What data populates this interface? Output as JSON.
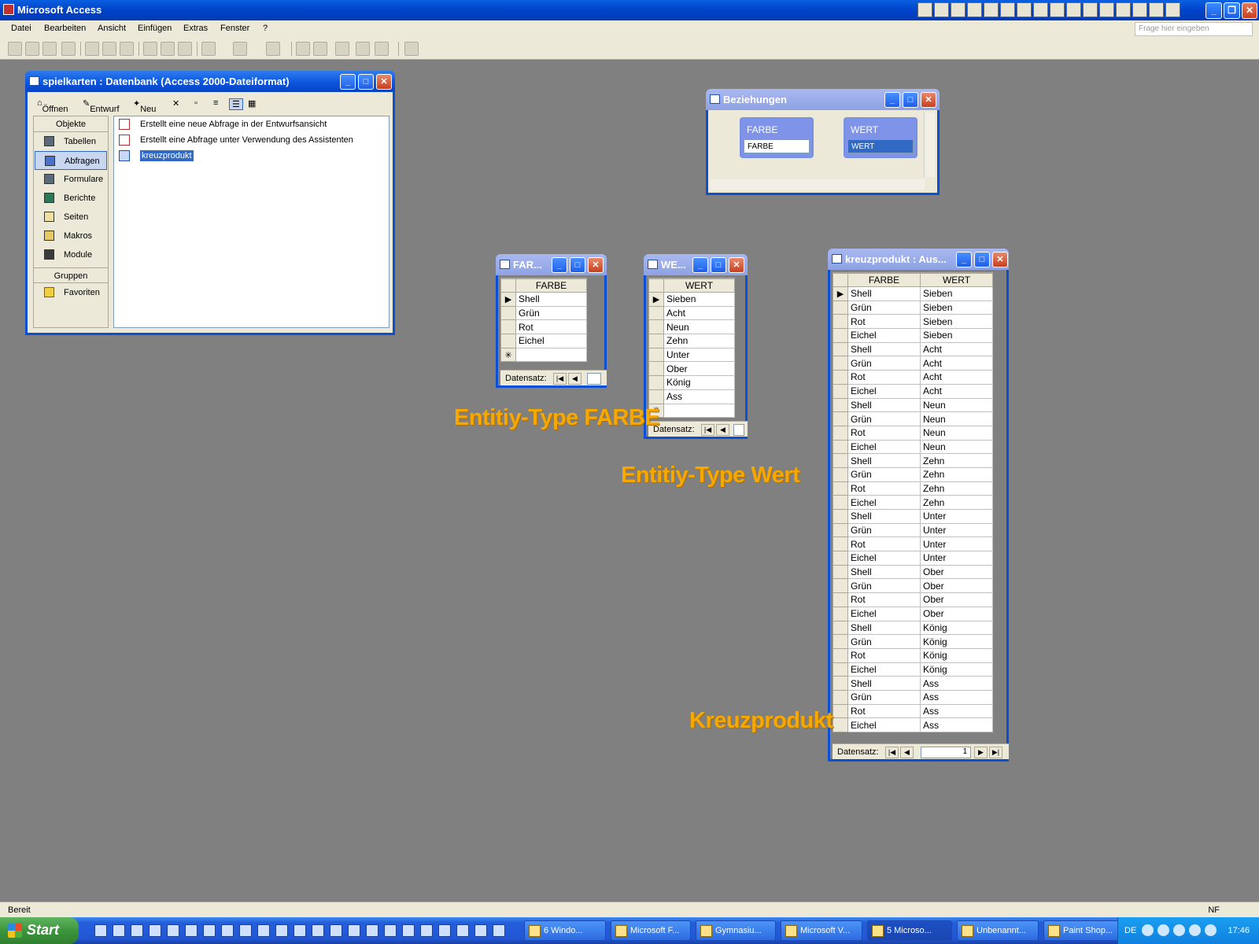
{
  "app": {
    "title": "Microsoft Access",
    "help_placeholder": "Frage hier eingeben",
    "status_left": "Bereit",
    "status_right": "NF"
  },
  "menu": [
    "Datei",
    "Bearbeiten",
    "Ansicht",
    "Einfügen",
    "Extras",
    "Fenster",
    "?"
  ],
  "db_window": {
    "title": "spielkarten : Datenbank (Access 2000-Dateiformat)",
    "toolbar": {
      "open": "Öffnen",
      "design": "Entwurf",
      "new": "Neu"
    },
    "objects_header": "Objekte",
    "objects": [
      "Tabellen",
      "Abfragen",
      "Formulare",
      "Berichte",
      "Seiten",
      "Makros",
      "Module"
    ],
    "selected_object": "Abfragen",
    "groups_header": "Gruppen",
    "groups": [
      "Favoriten"
    ],
    "list": [
      "Erstellt eine neue Abfrage in der Entwurfsansicht",
      "Erstellt eine Abfrage unter Verwendung des Assistenten",
      "kreuzprodukt"
    ]
  },
  "relationships": {
    "title": "Beziehungen",
    "tables": [
      {
        "name": "FARBE",
        "field": "FARBE"
      },
      {
        "name": "WERT",
        "field": "WERT"
      }
    ]
  },
  "farbe_table": {
    "title": "FAR...",
    "column": "FARBE",
    "rows": [
      "Shell",
      "Grün",
      "Rot",
      "Eichel"
    ],
    "nav_label": "Datensatz:"
  },
  "wert_table": {
    "title": "WE...",
    "column": "WERT",
    "rows": [
      "Sieben",
      "Acht",
      "Neun",
      "Zehn",
      "Unter",
      "Ober",
      "König",
      "Ass"
    ],
    "nav_label": "Datensatz:"
  },
  "kreuz_table": {
    "title": "kreuzprodukt : Aus...",
    "columns": [
      "FARBE",
      "WERT"
    ],
    "rows": [
      [
        "Shell",
        "Sieben"
      ],
      [
        "Grün",
        "Sieben"
      ],
      [
        "Rot",
        "Sieben"
      ],
      [
        "Eichel",
        "Sieben"
      ],
      [
        "Shell",
        "Acht"
      ],
      [
        "Grün",
        "Acht"
      ],
      [
        "Rot",
        "Acht"
      ],
      [
        "Eichel",
        "Acht"
      ],
      [
        "Shell",
        "Neun"
      ],
      [
        "Grün",
        "Neun"
      ],
      [
        "Rot",
        "Neun"
      ],
      [
        "Eichel",
        "Neun"
      ],
      [
        "Shell",
        "Zehn"
      ],
      [
        "Grün",
        "Zehn"
      ],
      [
        "Rot",
        "Zehn"
      ],
      [
        "Eichel",
        "Zehn"
      ],
      [
        "Shell",
        "Unter"
      ],
      [
        "Grün",
        "Unter"
      ],
      [
        "Rot",
        "Unter"
      ],
      [
        "Eichel",
        "Unter"
      ],
      [
        "Shell",
        "Ober"
      ],
      [
        "Grün",
        "Ober"
      ],
      [
        "Rot",
        "Ober"
      ],
      [
        "Eichel",
        "Ober"
      ],
      [
        "Shell",
        "König"
      ],
      [
        "Grün",
        "König"
      ],
      [
        "Rot",
        "König"
      ],
      [
        "Eichel",
        "König"
      ],
      [
        "Shell",
        "Ass"
      ],
      [
        "Grün",
        "Ass"
      ],
      [
        "Rot",
        "Ass"
      ],
      [
        "Eichel",
        "Ass"
      ]
    ],
    "nav_label": "Datensatz:",
    "record_number": "1"
  },
  "annotations": {
    "farbe": "Entitiy-Type FARBE",
    "wert": "Entitiy-Type Wert",
    "kreuz": "Kreuzprodukt"
  },
  "taskbar": {
    "start": "Start",
    "tasks": [
      "6 Windo...",
      "Microsoft F...",
      "Gymnasiu...",
      "Microsoft V...",
      "5 Microso...",
      "Unbenannt...",
      "Paint Shop..."
    ],
    "language": "DE",
    "clock": "17:46"
  },
  "colors": {
    "annotation": "#f5a800",
    "workspace": "#808080",
    "title_blue": "#0a52dc"
  }
}
